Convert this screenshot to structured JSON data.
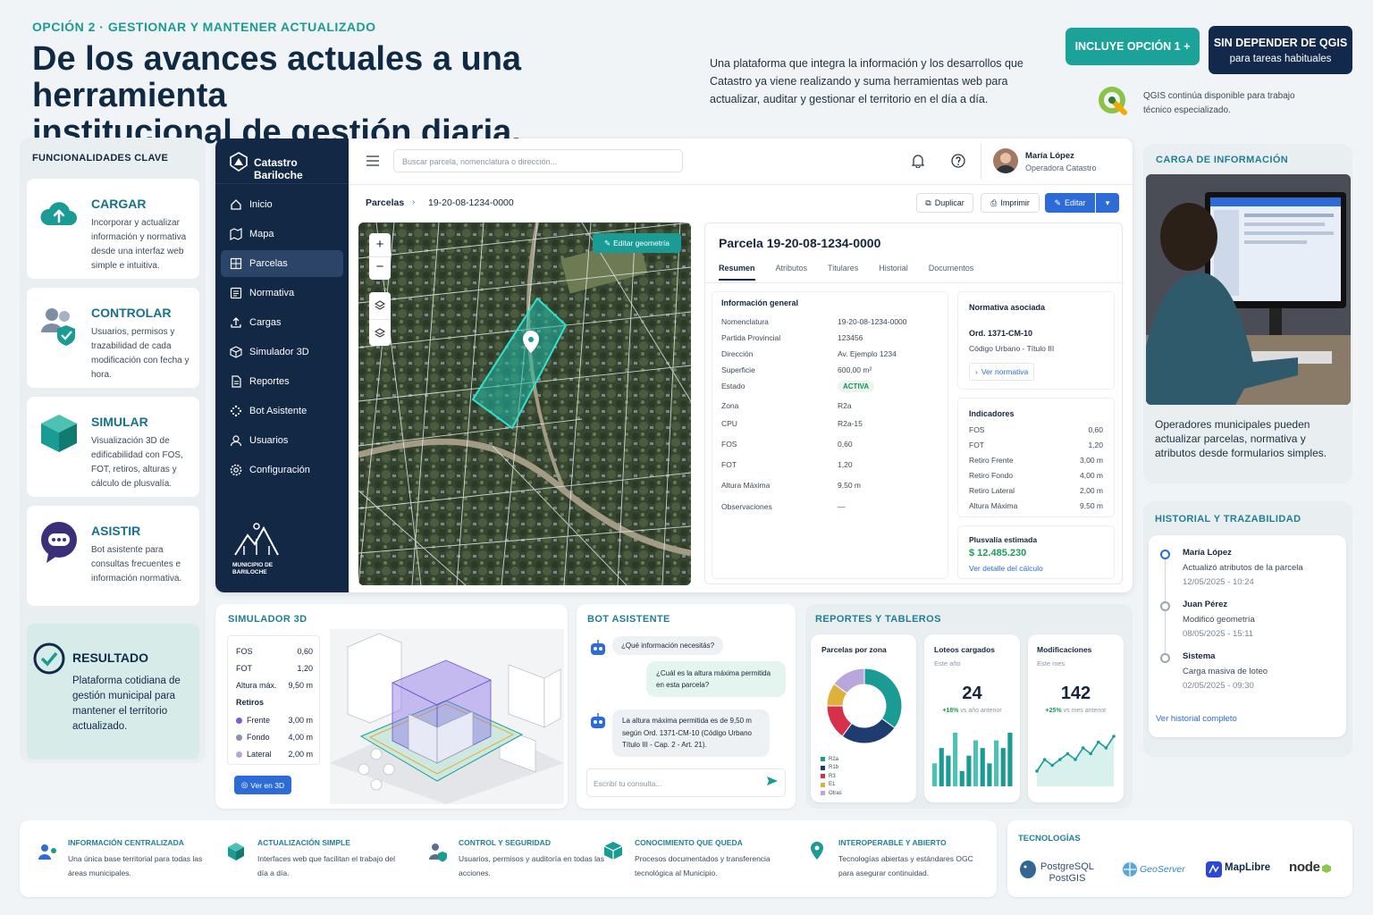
{
  "header": {
    "eyebrow": "OPCIÓN 2 · GESTIONAR Y MANTENER ACTUALIZADO",
    "headline_1": "De los avances actuales a una herramienta",
    "headline_2": "institucional de gestión diaria.",
    "intro": "Una plataforma que integra la información y los desarrollos que Catastro ya viene realizando y suma herramientas web para actualizar, auditar y gestionar el territorio en el día a día.",
    "badge_1": "INCLUYE OPCIÓN 1 +",
    "badge_2_title": "SIN DEPENDER DE QGIS",
    "badge_2_sub": "para tareas habituales",
    "qgis_note": "QGIS continúa disponible para trabajo técnico especializado."
  },
  "features": {
    "title": "FUNCIONALIDADES CLAVE",
    "items": [
      {
        "title": "CARGAR",
        "text": "Incorporar y actualizar información y normativa desde una interfaz web simple e intuitiva.",
        "icon": "cloud-upload-icon"
      },
      {
        "title": "CONTROLAR",
        "text": "Usuarios, permisos y trazabilidad de cada modificación con fecha y hora.",
        "icon": "users-shield-icon"
      },
      {
        "title": "SIMULAR",
        "text": "Visualización 3D de edificabilidad con FOS, FOT, retiros, alturas y cálculo de plusvalía.",
        "icon": "cube-icon"
      },
      {
        "title": "ASISTIR",
        "text": "Bot asistente para consultas frecuentes e información normativa.",
        "icon": "chat-bubble-icon"
      }
    ],
    "result_title": "RESULTADO",
    "result_text": "Plataforma cotidiana de gestión municipal para mantener el territorio actualizado."
  },
  "app": {
    "brand": "Catastro Bariloche",
    "search_placeholder": "Buscar parcela, nomenclatura o dirección...",
    "user_name": "María López",
    "user_role": "Operadora Catastro",
    "nav": [
      "Inicio",
      "Mapa",
      "Parcelas",
      "Normativa",
      "Cargas",
      "Simulador 3D",
      "Reportes",
      "Bot Asistente",
      "Usuarios",
      "Configuración"
    ],
    "active_nav": "Parcelas",
    "municipio": "MUNICIPIO DE BARILOCHE",
    "breadcrumb_root": "Parcelas",
    "breadcrumb_leaf": "19-20-08-1234-0000",
    "actions": {
      "duplicate": "Duplicar",
      "print": "Imprimir",
      "edit": "Editar"
    },
    "map_edit": "Editar geometría",
    "parcel_title": "Parcela 19-20-08-1234-0000",
    "tabs": [
      "Resumen",
      "Atributos",
      "Titulares",
      "Historial",
      "Documentos"
    ],
    "general_title": "Información general",
    "general": [
      {
        "k": "Nomenclatura",
        "v": "19-20-08-1234-0000"
      },
      {
        "k": "Partida Provincial",
        "v": "123456"
      },
      {
        "k": "Dirección",
        "v": "Av. Ejemplo 1234"
      },
      {
        "k": "Superficie",
        "v": "600,00 m²"
      },
      {
        "k": "Estado",
        "v": "ACTIVA"
      },
      {
        "k": "Zona",
        "v": "R2a"
      },
      {
        "k": "CPU",
        "v": "R2a-15"
      },
      {
        "k": "FOS",
        "v": "0,60"
      },
      {
        "k": "FOT",
        "v": "1,20"
      },
      {
        "k": "Altura Máxima",
        "v": "9,50 m"
      },
      {
        "k": "Observaciones",
        "v": "—"
      }
    ],
    "norm_title": "Normativa asociada",
    "norm_ord": "Ord. 1371-CM-10",
    "norm_code": "Código Urbano - Título III",
    "norm_link": "Ver normativa",
    "ind_title": "Indicadores",
    "indicators": [
      {
        "k": "FOS",
        "v": "0,60"
      },
      {
        "k": "FOT",
        "v": "1,20"
      },
      {
        "k": "Retiro Frente",
        "v": "3,00 m"
      },
      {
        "k": "Retiro Fondo",
        "v": "4,00 m"
      },
      {
        "k": "Retiro Lateral",
        "v": "2,00 m"
      },
      {
        "k": "Altura Máxima",
        "v": "9,50 m"
      }
    ],
    "plusvalia_title": "Plusvalía estimada",
    "plusvalia_value": "$ 12.485.230",
    "plusvalia_link": "Ver detalle del cálculo"
  },
  "carga": {
    "title": "CARGA DE INFORMACIÓN",
    "text": "Operadores municipales pueden actualizar parcelas, normativa y atributos desde formularios simples."
  },
  "historial": {
    "title": "HISTORIAL Y TRAZABILIDAD",
    "items": [
      {
        "who": "María López",
        "what": "Actualizó atributos de la parcela",
        "when": "12/05/2025 - 10:24"
      },
      {
        "who": "Juan Pérez",
        "what": "Modificó geometría",
        "when": "08/05/2025 - 15:11"
      },
      {
        "who": "Sistema",
        "what": "Carga masiva de loteo",
        "when": "02/05/2025 - 09:30"
      }
    ],
    "link": "Ver historial completo"
  },
  "sim": {
    "title": "SIMULADOR 3D",
    "rows": [
      {
        "k": "FOS",
        "v": "0,60"
      },
      {
        "k": "FOT",
        "v": "1,20"
      },
      {
        "k": "Altura máx.",
        "v": "9,50 m"
      }
    ],
    "retiros_title": "Retiros",
    "retiros": [
      {
        "k": "Frente",
        "v": "3,00 m",
        "color": "#7b5cd6"
      },
      {
        "k": "Fondo",
        "v": "4,00 m",
        "color": "#8c8fb8"
      },
      {
        "k": "Lateral",
        "v": "2,00 m",
        "color": "#b8a4d8"
      }
    ],
    "button": "Ver en 3D"
  },
  "bot": {
    "title": "BOT ASISTENTE",
    "q1": "¿Qué información necesitás?",
    "q2": "¿Cuál es la altura máxima permitida en esta parcela?",
    "a1": "La altura máxima permitida es de 9,50 m según Ord. 1371-CM-10 (Código Urbano Título III - Cap. 2 - Art. 21).",
    "placeholder": "Escribí tu consulta..."
  },
  "reportes": {
    "title": "REPORTES Y TABLEROS",
    "zona_title": "Parcelas por zona",
    "legend": [
      {
        "name": "R2a",
        "color": "#1a9c95"
      },
      {
        "name": "R1b",
        "color": "#1f3c6e"
      },
      {
        "name": "R3",
        "color": "#d6304a"
      },
      {
        "name": "E1",
        "color": "#e0b13a"
      },
      {
        "name": "Otras",
        "color": "#b9a6da"
      }
    ],
    "lotes_title": "Loteos cargados",
    "lotes_sub": "Este año",
    "lotes_value": "24",
    "lotes_delta": "+18%",
    "lotes_delta_note": "vs año anterior",
    "mod_title": "Modificaciones",
    "mod_sub": "Este mes",
    "mod_value": "142",
    "mod_delta": "+25%",
    "mod_delta_note": "vs mes anterior"
  },
  "chart_data": [
    {
      "type": "pie",
      "title": "Parcelas por zona",
      "categories": [
        "R2a",
        "R1b",
        "R3",
        "E1",
        "Otras"
      ],
      "values": [
        35,
        25,
        15,
        10,
        15
      ]
    },
    {
      "type": "bar",
      "title": "Loteos cargados",
      "values": [
        3,
        5,
        4,
        7,
        2,
        4,
        6,
        5,
        3,
        6,
        5,
        7
      ]
    },
    {
      "type": "line",
      "title": "Modificaciones",
      "values": [
        2,
        4,
        3,
        4,
        5,
        4,
        6,
        5,
        7,
        6,
        8
      ]
    }
  ],
  "benefits": [
    {
      "title": "INFORMACIÓN CENTRALIZADA",
      "text": "Una única base territorial para todas las áreas municipales.",
      "icon": "users-pin-icon"
    },
    {
      "title": "ACTUALIZACIÓN SIMPLE",
      "text": "Interfaces web que facilitan el trabajo del día a día.",
      "icon": "cube-edit-icon"
    },
    {
      "title": "CONTROL Y SEGURIDAD",
      "text": "Usuarios, permisos y auditoría en todas las acciones.",
      "icon": "user-shield-icon"
    },
    {
      "title": "CONOCIMIENTO QUE QUEDA",
      "text": "Procesos documentados y transferencia tecnológica al Municipio.",
      "icon": "box-icon"
    },
    {
      "title": "INTEROPERABLE Y ABIERTO",
      "text": "Tecnologías abiertas y estándares OGC para asegurar continuidad.",
      "icon": "map-pin-icon"
    }
  ],
  "tech": {
    "title": "TECNOLOGÍAS",
    "items": [
      "PostgreSQL",
      "PostGIS",
      "GeoServer",
      "MapLibre",
      "node"
    ]
  }
}
